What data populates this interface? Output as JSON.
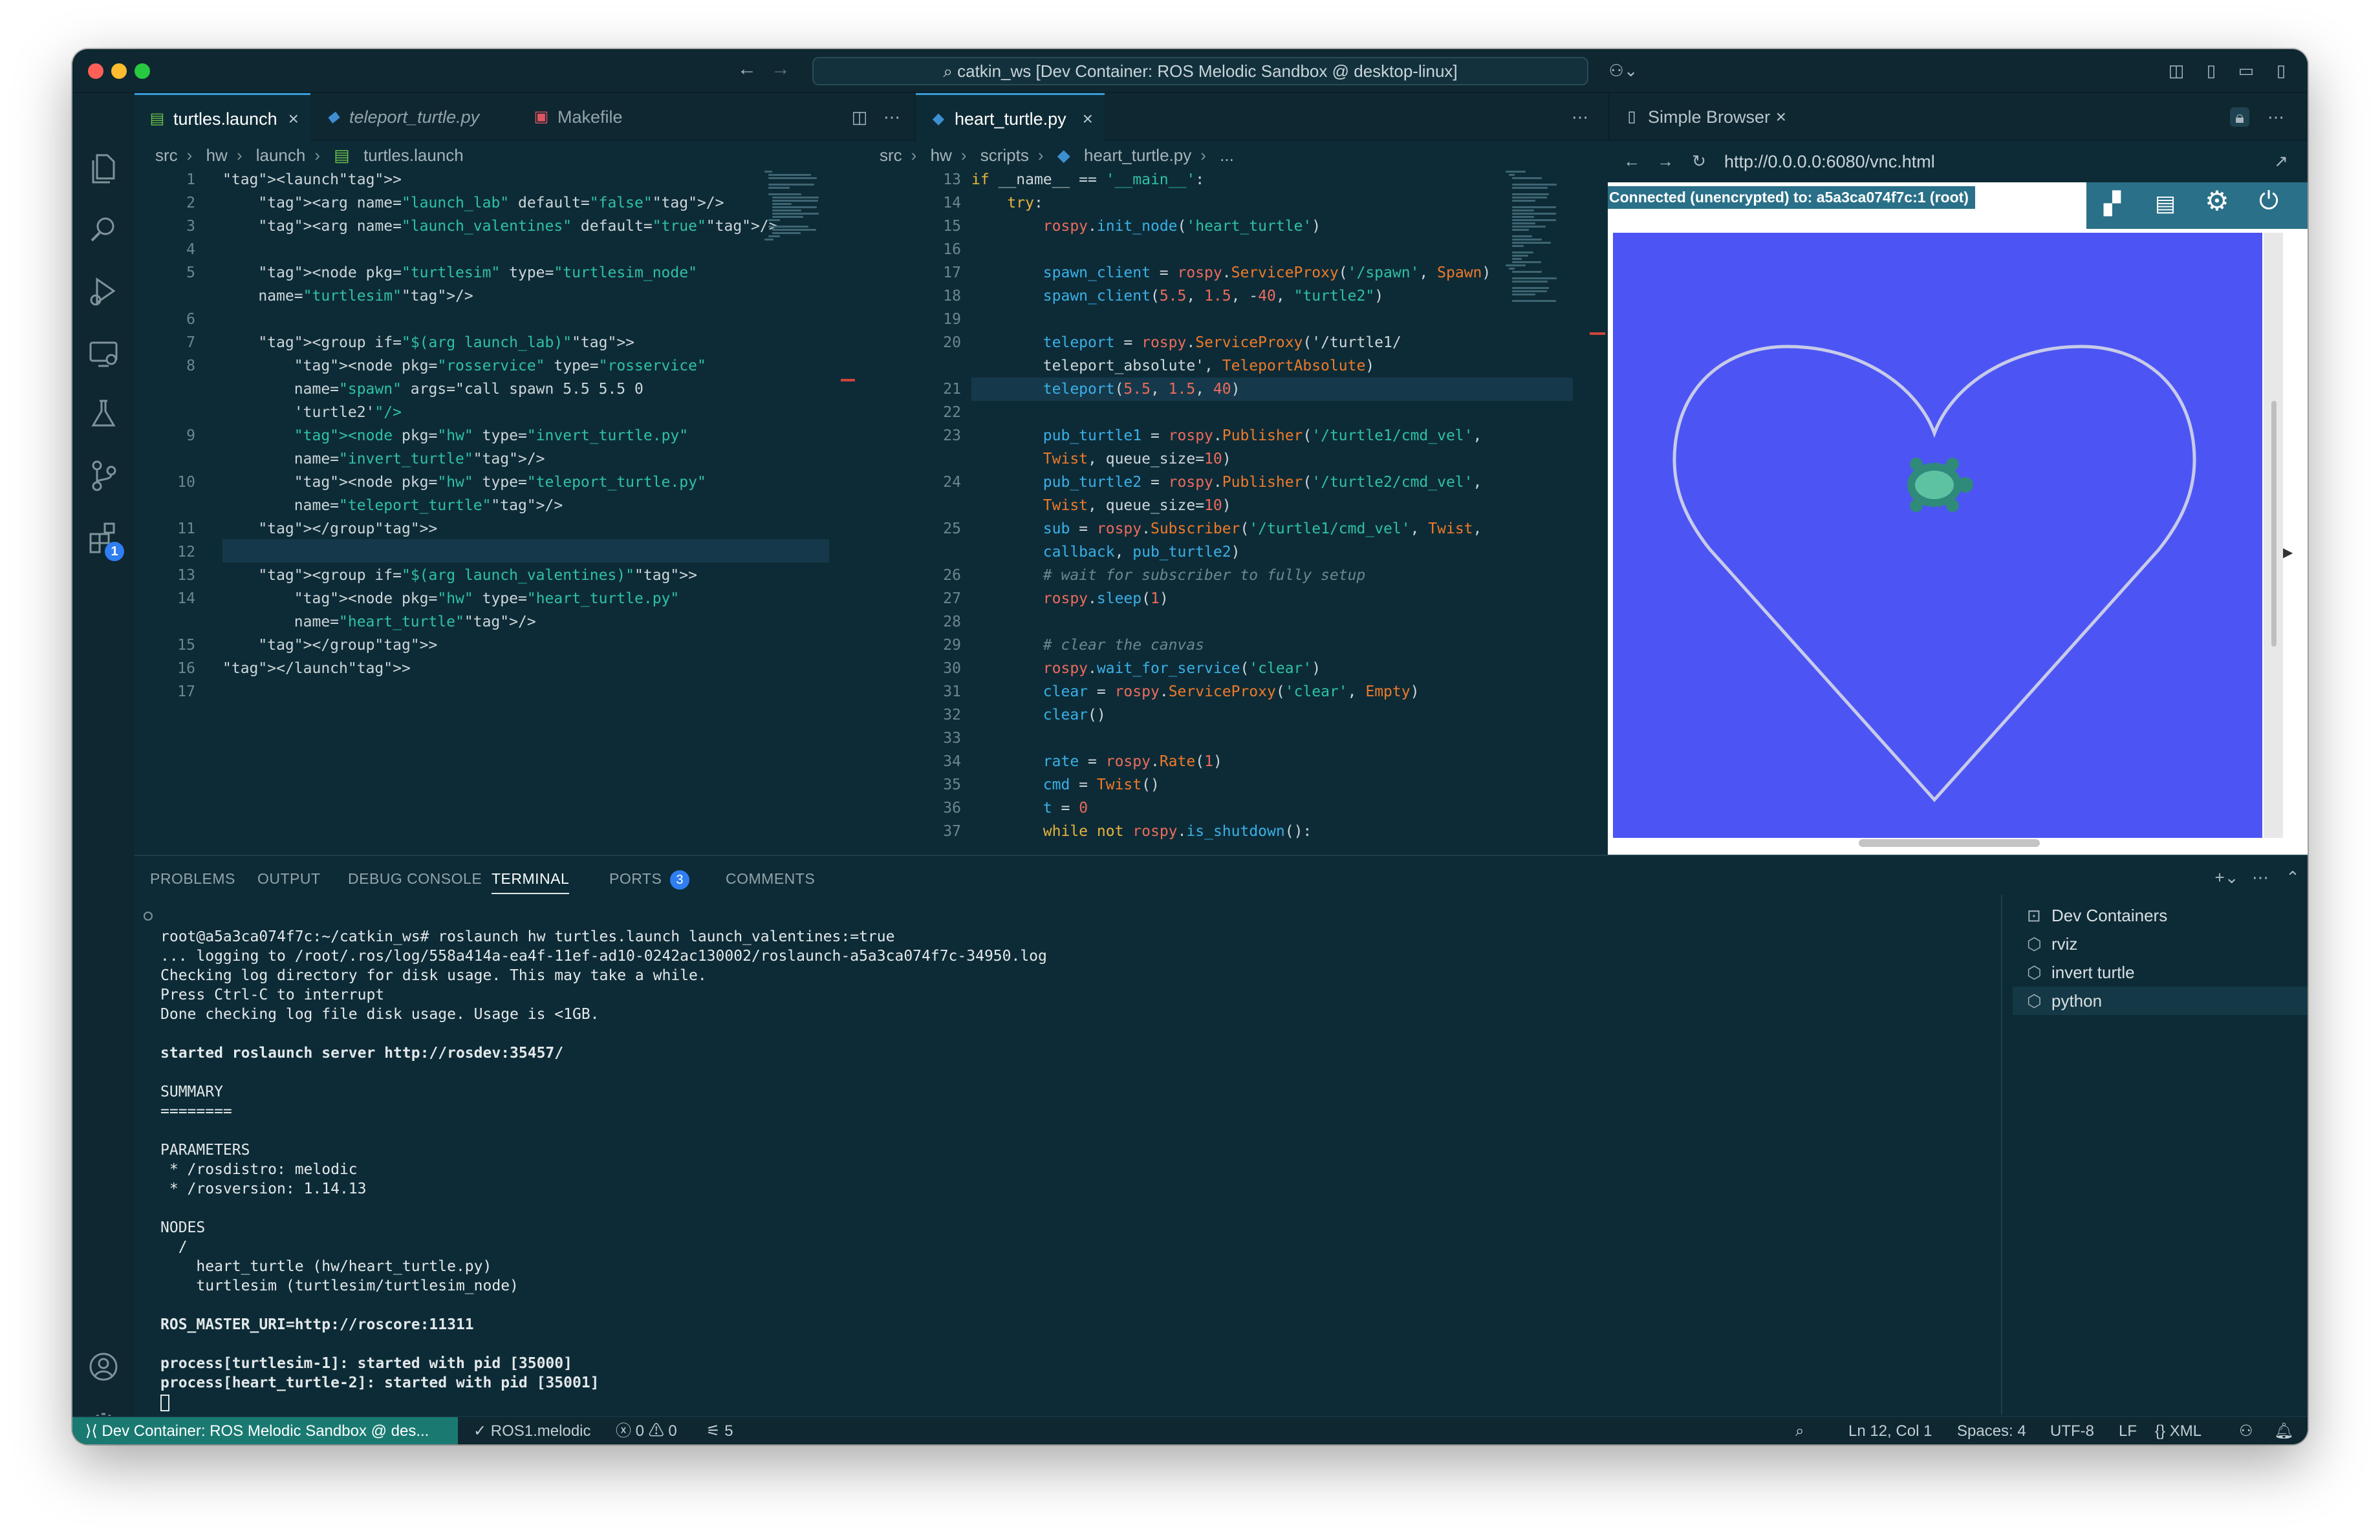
{
  "title_bar": {
    "command_center": "catkin_ws [Dev Container: ROS Melodic Sandbox @ desktop-linux]"
  },
  "editor_left": {
    "tabs": [
      {
        "label": "turtles.launch",
        "active": true
      },
      {
        "label": "teleport_turtle.py",
        "active": false
      },
      {
        "label": "Makefile",
        "active": false
      }
    ],
    "breadcrumb": [
      "src",
      "hw",
      "launch",
      "turtles.launch"
    ],
    "line_numbers": "1\n2\n3\n4\n5\n\n6\n7\n8\n\n\n9\n\n10\n\n11\n12\n13\n14\n\n15\n16\n17",
    "code": [
      "<launch>",
      "    <arg name=\"launch_lab\" default=\"false\"/>",
      "    <arg name=\"launch_valentines\" default=\"true\"/>",
      "",
      "    <node pkg=\"turtlesim\" type=\"turtlesim_node\"",
      "    name=\"turtlesim\"/>",
      "",
      "    <group if=\"$(arg launch_lab)\">",
      "        <node pkg=\"rosservice\" type=\"rosservice\"",
      "        name=\"spawn\" args=\"call spawn 5.5 5.5 0",
      "        'turtle2'\"/>",
      "        <node pkg=\"hw\" type=\"invert_turtle.py\"",
      "        name=\"invert_turtle\"/>",
      "        <node pkg=\"hw\" type=\"teleport_turtle.py\"",
      "        name=\"teleport_turtle\"/>",
      "    </group>",
      "",
      "    <group if=\"$(arg launch_valentines)\">",
      "        <node pkg=\"hw\" type=\"heart_turtle.py\"",
      "        name=\"heart_turtle\"/>",
      "    </group>",
      "</launch>",
      ""
    ]
  },
  "editor_middle": {
    "tabs": [
      {
        "label": "heart_turtle.py",
        "active": true
      }
    ],
    "breadcrumb": [
      "src",
      "hw",
      "scripts",
      "heart_turtle.py",
      "..."
    ],
    "line_numbers": "13\n14\n15\n16\n17\n18\n19\n20\n\n21\n22\n23\n\n24\n\n25\n\n26\n27\n28\n29\n30\n31\n32\n33\n34\n35\n36\n37",
    "code": [
      "if __name__ == '__main__':",
      "    try:",
      "        rospy.init_node('heart_turtle')",
      "",
      "        spawn_client = rospy.ServiceProxy('/spawn', Spawn)",
      "        spawn_client(5.5, 1.5, -40, \"turtle2\")",
      "",
      "        teleport = rospy.ServiceProxy('/turtle1/",
      "        teleport_absolute', TeleportAbsolute)",
      "        teleport(5.5, 1.5, 40)",
      "",
      "        pub_turtle1 = rospy.Publisher('/turtle1/cmd_vel',",
      "        Twist, queue_size=10)",
      "        pub_turtle2 = rospy.Publisher('/turtle2/cmd_vel',",
      "        Twist, queue_size=10)",
      "        sub = rospy.Subscriber('/turtle1/cmd_vel', Twist,",
      "        callback, pub_turtle2)",
      "        # wait for subscriber to fully setup",
      "        rospy.sleep(1)",
      "",
      "        # clear the canvas",
      "        rospy.wait_for_service('clear')",
      "        clear = rospy.ServiceProxy('clear', Empty)",
      "        clear()",
      "",
      "        rate = rospy.Rate(1)",
      "        cmd = Twist()",
      "        t = 0",
      "        while not rospy.is_shutdown():"
    ]
  },
  "simple_browser": {
    "tab_label": "Simple Browser",
    "url": "http://0.0.0.0:6080/vnc.html",
    "vnc_status": "Connected (unencrypted) to: a5a3ca074f7c:1 (root)"
  },
  "panel": {
    "tabs": [
      "PROBLEMS",
      "OUTPUT",
      "DEBUG CONSOLE",
      "TERMINAL",
      "PORTS",
      "COMMENTS"
    ],
    "ports_count": "3",
    "terminal_prompt": "root@a5a3ca074f7c:~/catkin_ws# roslaunch hw turtles.launch launch_valentines:=true",
    "terminal_lines": [
      "... logging to /root/.ros/log/558a414a-ea4f-11ef-ad10-0242ac130002/roslaunch-a5a3ca074f7c-34950.log",
      "Checking log directory for disk usage. This may take a while.",
      "Press Ctrl-C to interrupt",
      "Done checking log file disk usage. Usage is <1GB."
    ],
    "terminal_server": "started roslaunch server http://rosdev:35457/",
    "terminal_summary": "SUMMARY\n========",
    "terminal_params": "PARAMETERS\n * /rosdistro: melodic\n * /rosversion: 1.14.13",
    "terminal_nodes": "NODES\n  /\n    heart_turtle (hw/heart_turtle.py)\n    turtlesim (turtlesim/turtlesim_node)",
    "terminal_master": "ROS_MASTER_URI=http://roscore:11311",
    "terminal_process": "process[turtlesim-1]: started with pid [35000]\nprocess[heart_turtle-2]: started with pid [35001]",
    "terminal_list": [
      "Dev Containers",
      "rviz",
      "invert turtle",
      "python"
    ]
  },
  "status_bar": {
    "remote": "Dev Container: ROS Melodic Sandbox @ des...",
    "ros": "ROS1.melodic",
    "problems": "0",
    "warnings": "0",
    "ports": "5",
    "cursor": "Ln 12, Col 1",
    "spaces": "Spaces: 4",
    "encoding": "UTF-8",
    "eol": "LF",
    "language": "XML"
  },
  "colors": {
    "editor_bg": "#0d2b36",
    "accent": "#3a9bd6",
    "remote_bg": "#1a7a72",
    "turtlesim_bg": "#4c55f3"
  }
}
